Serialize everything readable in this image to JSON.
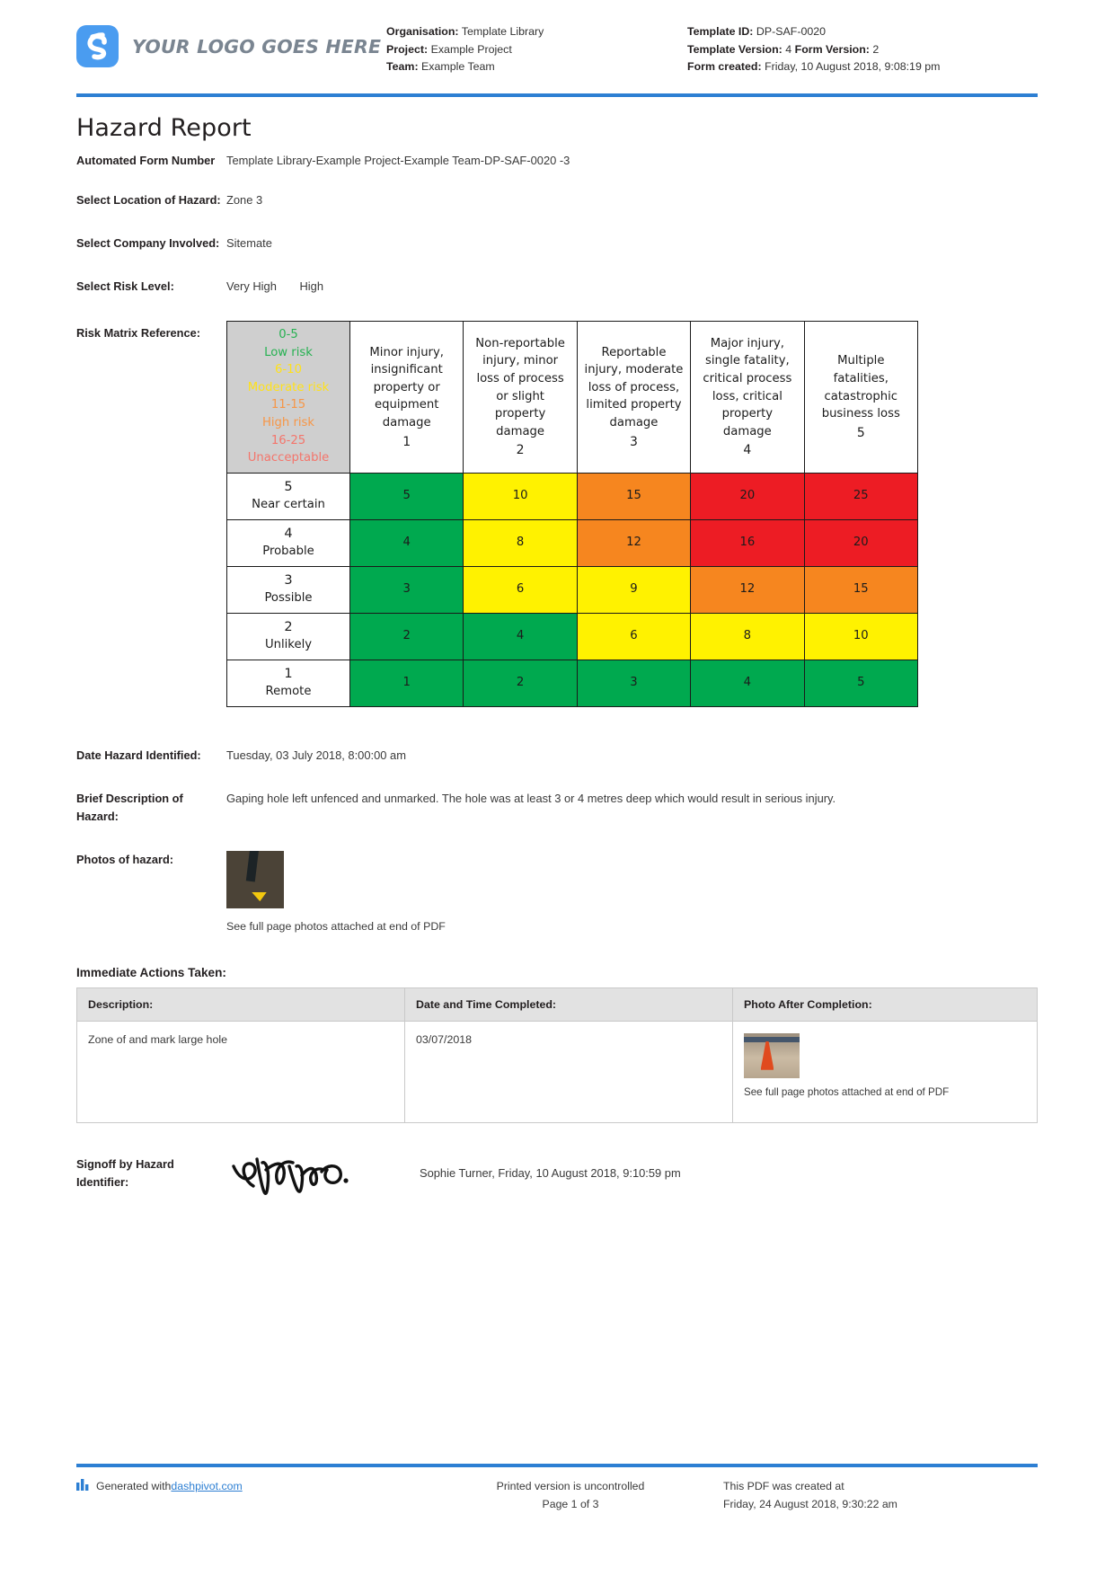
{
  "header": {
    "logo_text": "YOUR LOGO GOES HERE",
    "left_meta": [
      {
        "label": "Organisation:",
        "value": "Template Library"
      },
      {
        "label": "Project:",
        "value": "Example Project"
      },
      {
        "label": "Team:",
        "value": "Example Team"
      }
    ],
    "right_meta": [
      {
        "label": "Template ID:",
        "value": "DP-SAF-0020"
      },
      {
        "label": "Template Version:",
        "value": "4",
        "label2": "Form Version:",
        "value2": "2"
      },
      {
        "label": "Form created:",
        "value": "Friday, 10 August 2018, 9:08:19 pm"
      }
    ]
  },
  "title": "Hazard Report",
  "fields": {
    "form_number_label": "Automated Form Number",
    "form_number_value": "Template Library-Example Project-Example Team-DP-SAF-0020   -3",
    "location_label": "Select Location of Hazard:",
    "location_value": "Zone 3",
    "company_label": "Select Company Involved:",
    "company_value": "Sitemate",
    "risk_label": "Select Risk Level:",
    "risk_value_1": "Very High",
    "risk_value_2": "High",
    "matrix_label": "Risk Matrix Reference:",
    "date_label": "Date Hazard Identified:",
    "date_value": "Tuesday, 03 July 2018, 8:00:00 am",
    "description_label": "Brief Description of Hazard:",
    "description_value": "Gaping hole left unfenced and unmarked. The hole was at least 3 or 4 metres deep which would result in serious injury.",
    "photos_label": "Photos of hazard:",
    "photos_caption": "See full page photos attached at end of PDF"
  },
  "risk_matrix": {
    "legend": [
      {
        "range": "0-5",
        "name": "Low risk",
        "color": "#27b152"
      },
      {
        "range": "6-10",
        "name": "Moderate risk",
        "color": "#ffe11a"
      },
      {
        "range": "11-15",
        "name": "High risk",
        "color": "#f79646"
      },
      {
        "range": "16-25",
        "name": "Unacceptable",
        "color": "#f4756b"
      }
    ],
    "columns": [
      {
        "text": "Minor injury, insignificant property or equipment damage",
        "num": "1"
      },
      {
        "text": "Non-reportable injury, minor loss of process or slight property damage",
        "num": "2"
      },
      {
        "text": "Reportable injury, moderate loss of process, limited property damage",
        "num": "3"
      },
      {
        "text": "Major injury, single fatality, critical process loss, critical property damage",
        "num": "4"
      },
      {
        "text": "Multiple fatalities, catastrophic business loss",
        "num": "5"
      }
    ],
    "rows": [
      {
        "num": "5",
        "name": "Near certain",
        "cells": [
          {
            "v": "5",
            "color": "green"
          },
          {
            "v": "10",
            "color": "yellow"
          },
          {
            "v": "15",
            "color": "orange"
          },
          {
            "v": "20",
            "color": "red"
          },
          {
            "v": "25",
            "color": "red"
          }
        ]
      },
      {
        "num": "4",
        "name": "Probable",
        "cells": [
          {
            "v": "4",
            "color": "green"
          },
          {
            "v": "8",
            "color": "yellow"
          },
          {
            "v": "12",
            "color": "orange"
          },
          {
            "v": "16",
            "color": "red"
          },
          {
            "v": "20",
            "color": "red"
          }
        ]
      },
      {
        "num": "3",
        "name": "Possible",
        "cells": [
          {
            "v": "3",
            "color": "green"
          },
          {
            "v": "6",
            "color": "yellow"
          },
          {
            "v": "9",
            "color": "yellow"
          },
          {
            "v": "12",
            "color": "orange"
          },
          {
            "v": "15",
            "color": "orange"
          }
        ]
      },
      {
        "num": "2",
        "name": "Unlikely",
        "cells": [
          {
            "v": "2",
            "color": "green"
          },
          {
            "v": "4",
            "color": "green"
          },
          {
            "v": "6",
            "color": "yellow"
          },
          {
            "v": "8",
            "color": "yellow"
          },
          {
            "v": "10",
            "color": "yellow"
          }
        ]
      },
      {
        "num": "1",
        "name": "Remote",
        "cells": [
          {
            "v": "1",
            "color": "green"
          },
          {
            "v": "2",
            "color": "green"
          },
          {
            "v": "3",
            "color": "green"
          },
          {
            "v": "4",
            "color": "green"
          },
          {
            "v": "5",
            "color": "green"
          }
        ]
      }
    ],
    "colors": {
      "green": "#00a94f",
      "yellow": "#fff200",
      "orange": "#f6861f",
      "red": "#ed1c24",
      "legend_bg": "#cfcfcf"
    }
  },
  "immediate_actions": {
    "section_title": "Immediate Actions Taken:",
    "headers": [
      "Description:",
      "Date and Time Completed:",
      "Photo After Completion:"
    ],
    "rows": [
      {
        "description": "Zone of and mark large hole",
        "date": "03/07/2018",
        "photo_caption": "See full page photos attached at end of PDF"
      }
    ]
  },
  "signoff": {
    "label": "Signoff by Hazard Identifier:",
    "name_and_date": "Sophie Turner, Friday, 10 August 2018, 9:10:59 pm"
  },
  "footer": {
    "generated_prefix": "Generated with ",
    "generated_link": "dashpivot.com",
    "uncontrolled": "Printed version is uncontrolled",
    "page": "Page 1 of 3",
    "created_at_label": "This PDF was created at",
    "created_at_value": "Friday, 24 August 2018, 9:30:22 am"
  },
  "accent_color": "#2d7fd3"
}
